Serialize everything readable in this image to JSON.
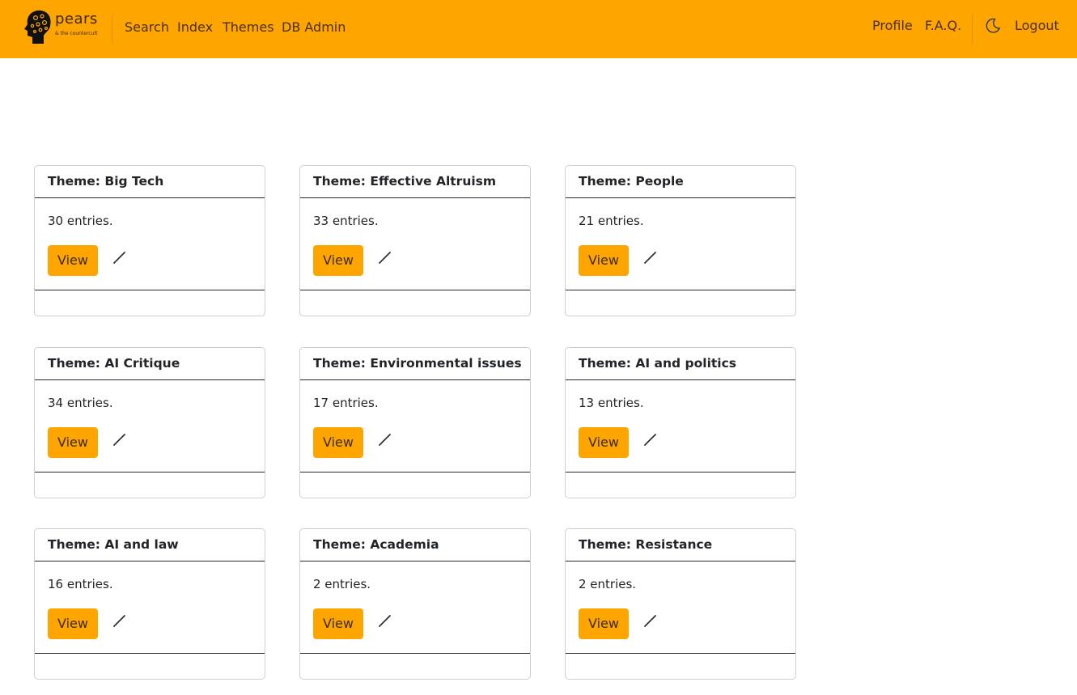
{
  "brand": {
    "name": "pears",
    "tagline": "& the countercult"
  },
  "nav": {
    "left": [
      {
        "label": "Search"
      },
      {
        "label": "Index"
      },
      {
        "label": "Themes"
      },
      {
        "label": "DB Admin"
      }
    ],
    "profile": "Profile",
    "faq": "F.A.Q.",
    "logout": "Logout"
  },
  "themes": [
    {
      "title": "Theme: Big Tech",
      "entries": "30 entries.",
      "view_label": "View"
    },
    {
      "title": "Theme: Effective Altruism",
      "entries": "33 entries.",
      "view_label": "View"
    },
    {
      "title": "Theme: People",
      "entries": "21 entries.",
      "view_label": "View"
    },
    {
      "title": "Theme: AI Critique",
      "entries": "34 entries.",
      "view_label": "View"
    },
    {
      "title": "Theme: Environmental issues",
      "entries": "17 entries.",
      "view_label": "View"
    },
    {
      "title": "Theme: AI and politics",
      "entries": "13 entries.",
      "view_label": "View"
    },
    {
      "title": "Theme: AI and law",
      "entries": "16 entries.",
      "view_label": "View"
    },
    {
      "title": "Theme: Academia",
      "entries": "2 entries.",
      "view_label": "View"
    },
    {
      "title": "Theme: Resistance",
      "entries": "2 entries.",
      "view_label": "View"
    }
  ],
  "colors": {
    "accent": "#ffa500",
    "text": "#212529"
  }
}
